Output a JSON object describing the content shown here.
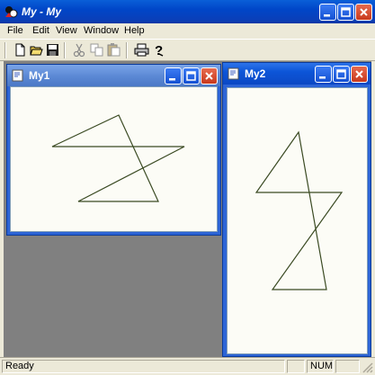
{
  "app": {
    "title": "My - My"
  },
  "menu": {
    "items": [
      "File",
      "Edit",
      "View",
      "Window",
      "Help"
    ]
  },
  "toolbar": {
    "buttons": [
      "new-icon",
      "open-icon",
      "save-icon",
      "cut-icon",
      "copy-icon",
      "paste-icon",
      "print-icon",
      "help-icon"
    ]
  },
  "child1": {
    "title": "My1"
  },
  "child2": {
    "title": "My2"
  },
  "status": {
    "text": "Ready",
    "num": "NUM"
  },
  "colors": {
    "title_bar": "#0046c8",
    "star_stroke": "#3a4a22",
    "mdi_background": "#808080"
  }
}
